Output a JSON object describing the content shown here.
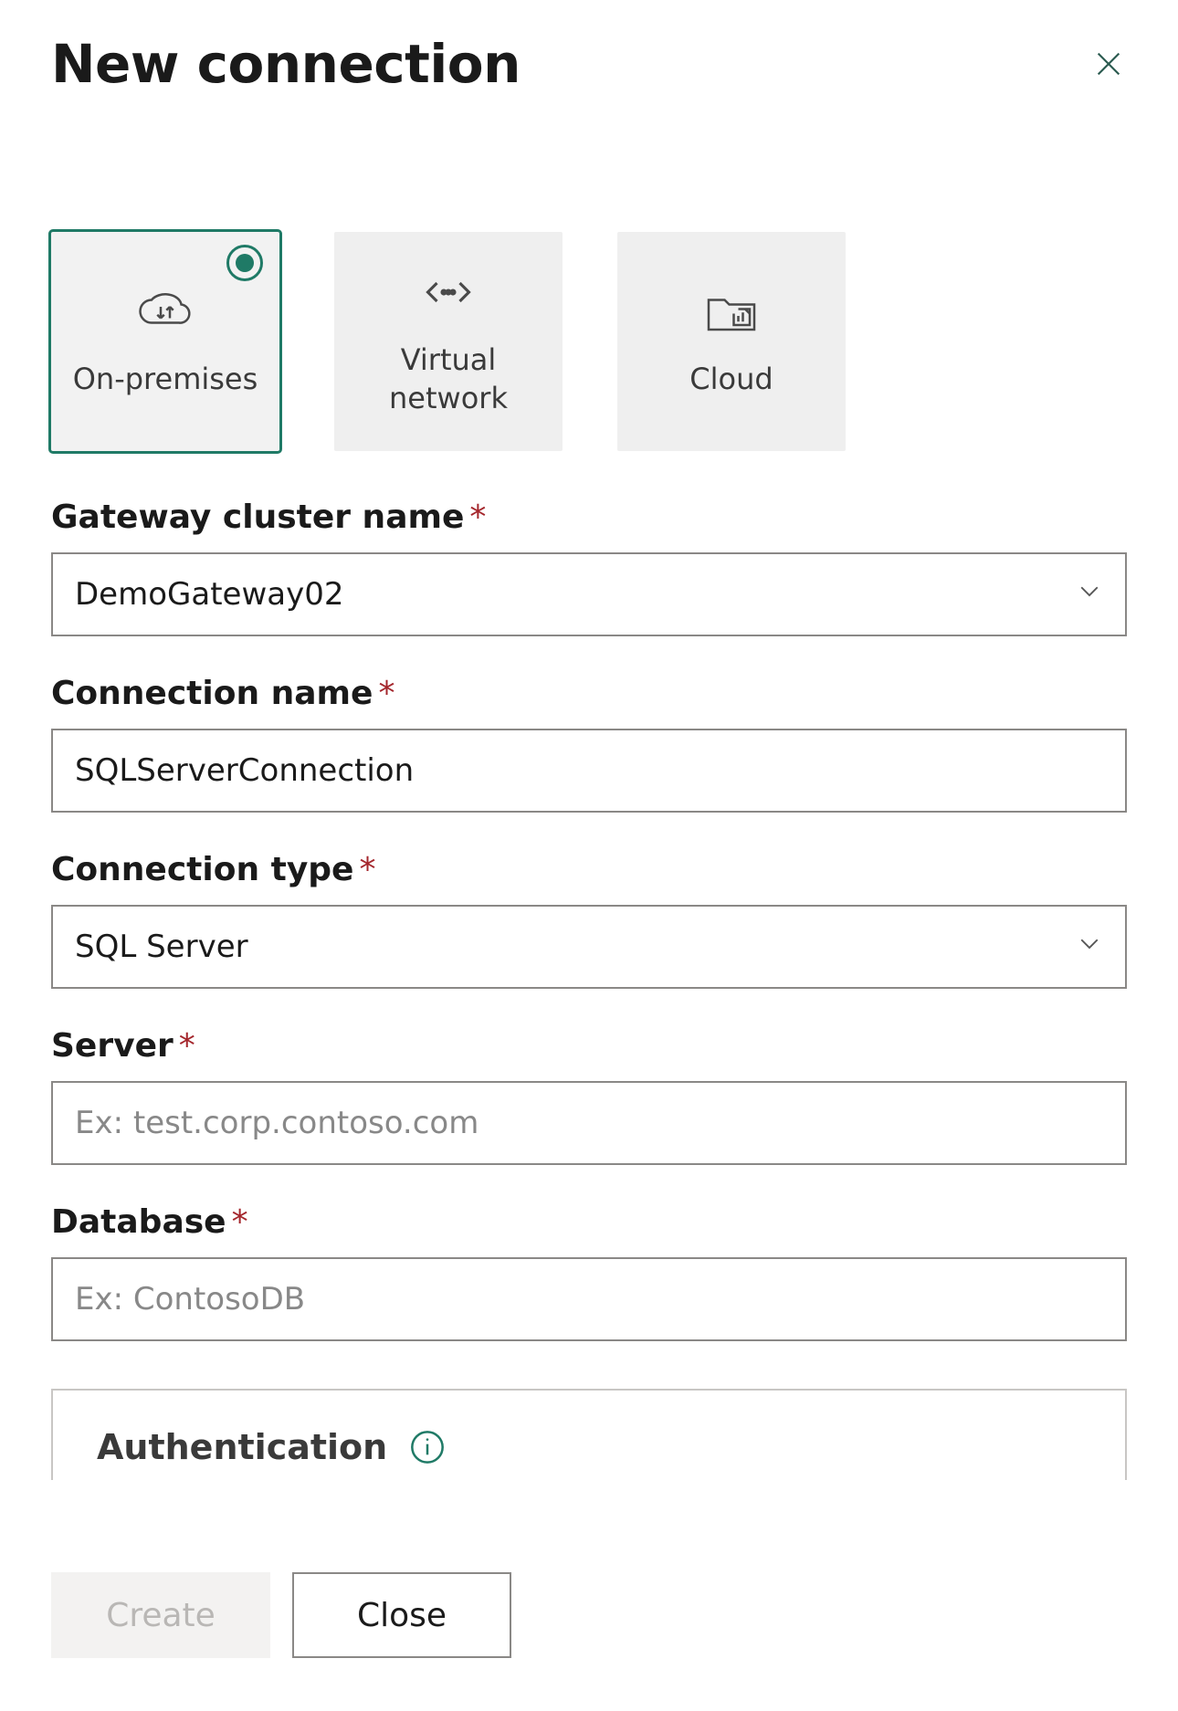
{
  "header": {
    "title": "New connection"
  },
  "types": {
    "onprem": "On-premises",
    "vnet": "Virtual network",
    "cloud": "Cloud"
  },
  "fields": {
    "gateway": {
      "label": "Gateway cluster name",
      "value": "DemoGateway02"
    },
    "connection_name": {
      "label": "Connection name",
      "value": "SQLServerConnection"
    },
    "connection_type": {
      "label": "Connection type",
      "value": "SQL Server"
    },
    "server": {
      "label": "Server",
      "placeholder": "Ex: test.corp.contoso.com",
      "value": ""
    },
    "database": {
      "label": "Database",
      "placeholder": "Ex: ContosoDB",
      "value": ""
    },
    "auth": {
      "title": "Authentication"
    }
  },
  "buttons": {
    "create": "Create",
    "close": "Close"
  },
  "required_marker": "*"
}
